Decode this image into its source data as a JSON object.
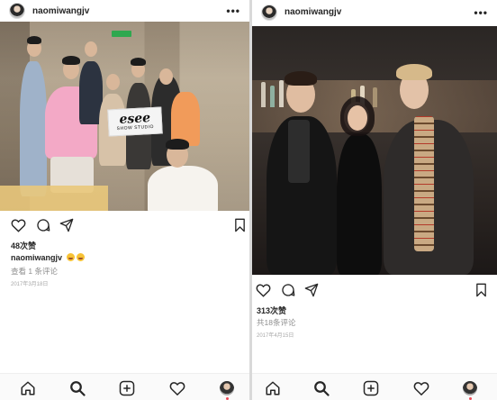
{
  "left_post": {
    "username": "naomiwangjv",
    "more_label": "•••",
    "photo": {
      "sign_brand": "esee",
      "sign_sub": "SHOW STUDIO"
    },
    "likes": "48次赞",
    "caption_user": "naomiwangjv",
    "comments": "查看 1 条评论",
    "date": "2017年3月18日"
  },
  "right_post": {
    "username": "naomiwangjv",
    "more_label": "•••",
    "likes": "313次赞",
    "comments": "共18条评论",
    "date": "2017年4月15日"
  },
  "icons": {
    "like": "heart-outline-icon",
    "comment": "speech-bubble-icon",
    "share": "paper-plane-icon",
    "save": "bookmark-icon",
    "tab_home": "home-icon",
    "tab_search": "search-icon",
    "tab_add": "add-post-icon",
    "tab_activity": "heart-icon",
    "tab_profile": "profile-avatar"
  },
  "colors": {
    "notification_dot": "#ed4956",
    "meta_gray": "#8e8e8e",
    "text": "#262626"
  }
}
